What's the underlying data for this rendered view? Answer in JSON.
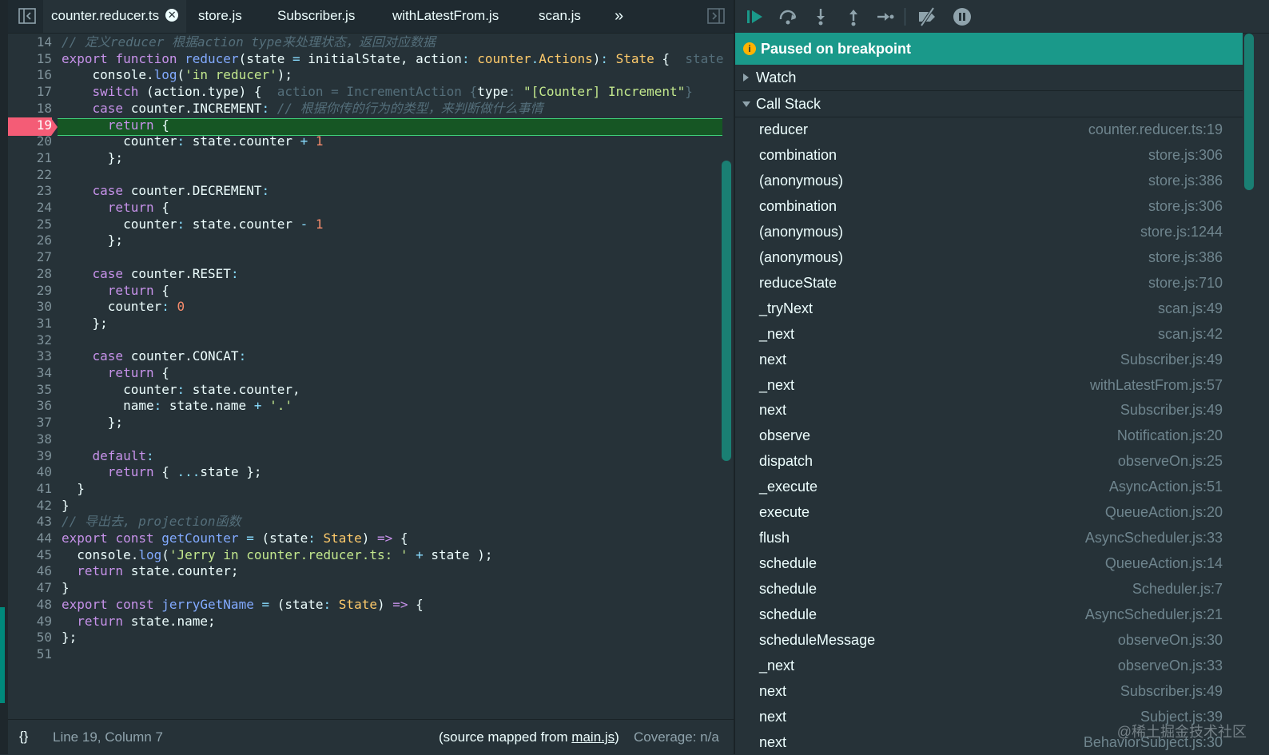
{
  "editor": {
    "tabs": [
      {
        "label": "counter.reducer.ts",
        "active": true
      },
      {
        "label": "store.js"
      },
      {
        "label": "Subscriber.js"
      },
      {
        "label": "withLatestFrom.js"
      },
      {
        "label": "scan.js"
      }
    ],
    "more_tabs_label": "»",
    "breakpoint_line": "19",
    "lines": [
      {
        "n": "14",
        "parts": [
          [
            "c",
            "// 定义reducer 根据action type来处理状态，返回对应数据"
          ]
        ]
      },
      {
        "n": "15",
        "parts": [
          [
            "k",
            "export "
          ],
          [
            "k",
            "function "
          ],
          [
            "f",
            "reducer"
          ],
          [
            "v",
            "(state "
          ],
          [
            "p",
            "= "
          ],
          [
            "v",
            "initialState, action"
          ],
          [
            "p",
            ": "
          ],
          [
            "t",
            "counter"
          ],
          [
            "p",
            "."
          ],
          [
            "t",
            "Actions"
          ],
          [
            "v",
            ")"
          ],
          [
            "p",
            ": "
          ],
          [
            "t",
            "State "
          ],
          [
            "v",
            "{  "
          ],
          [
            "inl",
            "state"
          ]
        ]
      },
      {
        "n": "16",
        "parts": [
          [
            "v",
            "    console."
          ],
          [
            "f",
            "log"
          ],
          [
            "v",
            "("
          ],
          [
            "s",
            "'in reducer'"
          ],
          [
            "v",
            ");"
          ]
        ]
      },
      {
        "n": "17",
        "parts": [
          [
            "v",
            "    "
          ],
          [
            "k",
            "switch "
          ],
          [
            "v",
            "(action.type) {  "
          ],
          [
            "inl",
            "action = IncrementAction {"
          ],
          [
            "v",
            "type"
          ],
          [
            "inl",
            ": "
          ],
          [
            "s",
            "\"[Counter] Increment\""
          ],
          [
            "inl",
            "}"
          ]
        ]
      },
      {
        "n": "18",
        "parts": [
          [
            "v",
            "    "
          ],
          [
            "k",
            "case "
          ],
          [
            "v",
            "counter."
          ],
          [
            "v",
            "INCREMENT"
          ],
          [
            "p",
            ": "
          ],
          [
            "c",
            "// 根据你传的行为的类型，来判断做什么事情"
          ]
        ]
      },
      {
        "n": "19",
        "parts": [
          [
            "v",
            "      "
          ],
          [
            "k",
            "return "
          ],
          [
            "v",
            "{"
          ]
        ]
      },
      {
        "n": "20",
        "parts": [
          [
            "v",
            "        counter"
          ],
          [
            "p",
            ": "
          ],
          [
            "v",
            "state.counter "
          ],
          [
            "p",
            "+ "
          ],
          [
            "n",
            "1"
          ]
        ]
      },
      {
        "n": "21",
        "parts": [
          [
            "v",
            "      };"
          ]
        ]
      },
      {
        "n": "22",
        "parts": []
      },
      {
        "n": "23",
        "parts": [
          [
            "v",
            "    "
          ],
          [
            "k",
            "case "
          ],
          [
            "v",
            "counter.DECREMENT"
          ],
          [
            "p",
            ":"
          ]
        ]
      },
      {
        "n": "24",
        "parts": [
          [
            "v",
            "      "
          ],
          [
            "k",
            "return "
          ],
          [
            "v",
            "{"
          ]
        ]
      },
      {
        "n": "25",
        "parts": [
          [
            "v",
            "        counter"
          ],
          [
            "p",
            ": "
          ],
          [
            "v",
            "state.counter "
          ],
          [
            "p",
            "- "
          ],
          [
            "n",
            "1"
          ]
        ]
      },
      {
        "n": "26",
        "parts": [
          [
            "v",
            "      };"
          ]
        ]
      },
      {
        "n": "27",
        "parts": []
      },
      {
        "n": "28",
        "parts": [
          [
            "v",
            "    "
          ],
          [
            "k",
            "case "
          ],
          [
            "v",
            "counter.RESET"
          ],
          [
            "p",
            ":"
          ]
        ]
      },
      {
        "n": "29",
        "parts": [
          [
            "v",
            "      "
          ],
          [
            "k",
            "return "
          ],
          [
            "v",
            "{"
          ]
        ]
      },
      {
        "n": "30",
        "parts": [
          [
            "v",
            "      counter"
          ],
          [
            "p",
            ": "
          ],
          [
            "n",
            "0"
          ]
        ]
      },
      {
        "n": "31",
        "parts": [
          [
            "v",
            "    };"
          ]
        ]
      },
      {
        "n": "32",
        "parts": []
      },
      {
        "n": "33",
        "parts": [
          [
            "v",
            "    "
          ],
          [
            "k",
            "case "
          ],
          [
            "v",
            "counter.CONCAT"
          ],
          [
            "p",
            ":"
          ]
        ]
      },
      {
        "n": "34",
        "parts": [
          [
            "v",
            "      "
          ],
          [
            "k",
            "return "
          ],
          [
            "v",
            "{"
          ]
        ]
      },
      {
        "n": "35",
        "parts": [
          [
            "v",
            "        counter"
          ],
          [
            "p",
            ": "
          ],
          [
            "v",
            "state.counter,"
          ]
        ]
      },
      {
        "n": "36",
        "parts": [
          [
            "v",
            "        name"
          ],
          [
            "p",
            ": "
          ],
          [
            "v",
            "state.name "
          ],
          [
            "p",
            "+ "
          ],
          [
            "s",
            "'.'"
          ]
        ]
      },
      {
        "n": "37",
        "parts": [
          [
            "v",
            "      };"
          ]
        ]
      },
      {
        "n": "38",
        "parts": []
      },
      {
        "n": "39",
        "parts": [
          [
            "v",
            "    "
          ],
          [
            "k",
            "default"
          ],
          [
            "p",
            ":"
          ]
        ]
      },
      {
        "n": "40",
        "parts": [
          [
            "v",
            "      "
          ],
          [
            "k",
            "return "
          ],
          [
            "v",
            "{ "
          ],
          [
            "p",
            "..."
          ],
          [
            "v",
            "state };"
          ]
        ]
      },
      {
        "n": "41",
        "parts": [
          [
            "v",
            "  }"
          ]
        ]
      },
      {
        "n": "42",
        "parts": [
          [
            "v",
            "}"
          ]
        ]
      },
      {
        "n": "43",
        "parts": [
          [
            "c",
            "// 导出去, projection函数"
          ]
        ]
      },
      {
        "n": "44",
        "parts": [
          [
            "k",
            "export "
          ],
          [
            "k",
            "const "
          ],
          [
            "f",
            "getCounter "
          ],
          [
            "p",
            "= "
          ],
          [
            "v",
            "(state"
          ],
          [
            "p",
            ": "
          ],
          [
            "t",
            "State"
          ],
          [
            "v",
            ") "
          ],
          [
            "k",
            "=> "
          ],
          [
            "v",
            "{"
          ]
        ]
      },
      {
        "n": "45",
        "parts": [
          [
            "v",
            "  console."
          ],
          [
            "f",
            "log"
          ],
          [
            "v",
            "("
          ],
          [
            "s",
            "'Jerry in counter.reducer.ts: ' "
          ],
          [
            "p",
            "+ "
          ],
          [
            "v",
            "state );"
          ]
        ]
      },
      {
        "n": "46",
        "parts": [
          [
            "v",
            "  "
          ],
          [
            "k",
            "return "
          ],
          [
            "v",
            "state.counter;"
          ]
        ]
      },
      {
        "n": "47",
        "parts": [
          [
            "v",
            "}"
          ]
        ]
      },
      {
        "n": "48",
        "parts": [
          [
            "k",
            "export "
          ],
          [
            "k",
            "const "
          ],
          [
            "f",
            "jerryGetName "
          ],
          [
            "p",
            "= "
          ],
          [
            "v",
            "(state"
          ],
          [
            "p",
            ": "
          ],
          [
            "t",
            "State"
          ],
          [
            "v",
            ") "
          ],
          [
            "k",
            "=> "
          ],
          [
            "v",
            "{"
          ]
        ]
      },
      {
        "n": "49",
        "parts": [
          [
            "v",
            "  "
          ],
          [
            "k",
            "return "
          ],
          [
            "v",
            "state.name;"
          ]
        ]
      },
      {
        "n": "50",
        "parts": [
          [
            "v",
            "};"
          ]
        ]
      },
      {
        "n": "51",
        "parts": []
      }
    ],
    "status": {
      "format_icon": "{}",
      "position": "Line 19, Column 7",
      "source_prefix": "(source mapped from ",
      "source_link": "main.js",
      "source_suffix": ")",
      "coverage": "Coverage: n/a"
    }
  },
  "debugger": {
    "paused_text": "Paused on breakpoint",
    "watch_label": "Watch",
    "callstack_label": "Call Stack",
    "frames": [
      {
        "fn": "reducer",
        "loc": "counter.reducer.ts:19"
      },
      {
        "fn": "combination",
        "loc": "store.js:306"
      },
      {
        "fn": "(anonymous)",
        "loc": "store.js:386"
      },
      {
        "fn": "combination",
        "loc": "store.js:306"
      },
      {
        "fn": "(anonymous)",
        "loc": "store.js:1244"
      },
      {
        "fn": "(anonymous)",
        "loc": "store.js:386"
      },
      {
        "fn": "reduceState",
        "loc": "store.js:710"
      },
      {
        "fn": "_tryNext",
        "loc": "scan.js:49"
      },
      {
        "fn": "_next",
        "loc": "scan.js:42"
      },
      {
        "fn": "next",
        "loc": "Subscriber.js:49"
      },
      {
        "fn": "_next",
        "loc": "withLatestFrom.js:57"
      },
      {
        "fn": "next",
        "loc": "Subscriber.js:49"
      },
      {
        "fn": "observe",
        "loc": "Notification.js:20"
      },
      {
        "fn": "dispatch",
        "loc": "observeOn.js:25"
      },
      {
        "fn": "_execute",
        "loc": "AsyncAction.js:51"
      },
      {
        "fn": "execute",
        "loc": "QueueAction.js:20"
      },
      {
        "fn": "flush",
        "loc": "AsyncScheduler.js:33"
      },
      {
        "fn": "schedule",
        "loc": "QueueAction.js:14"
      },
      {
        "fn": "schedule",
        "loc": "Scheduler.js:7"
      },
      {
        "fn": "schedule",
        "loc": "AsyncScheduler.js:21"
      },
      {
        "fn": "scheduleMessage",
        "loc": "observeOn.js:30"
      },
      {
        "fn": "_next",
        "loc": "observeOn.js:33"
      },
      {
        "fn": "next",
        "loc": "Subscriber.js:49"
      },
      {
        "fn": "next",
        "loc": "Subject.js:39"
      },
      {
        "fn": "next",
        "loc": "BehaviorSubject.js:30"
      }
    ]
  },
  "watermark": "@稀土掘金技术社区",
  "colors": {
    "accent": "#1a998a",
    "breakpoint": "#f45c76",
    "exec_line": "#165624"
  }
}
